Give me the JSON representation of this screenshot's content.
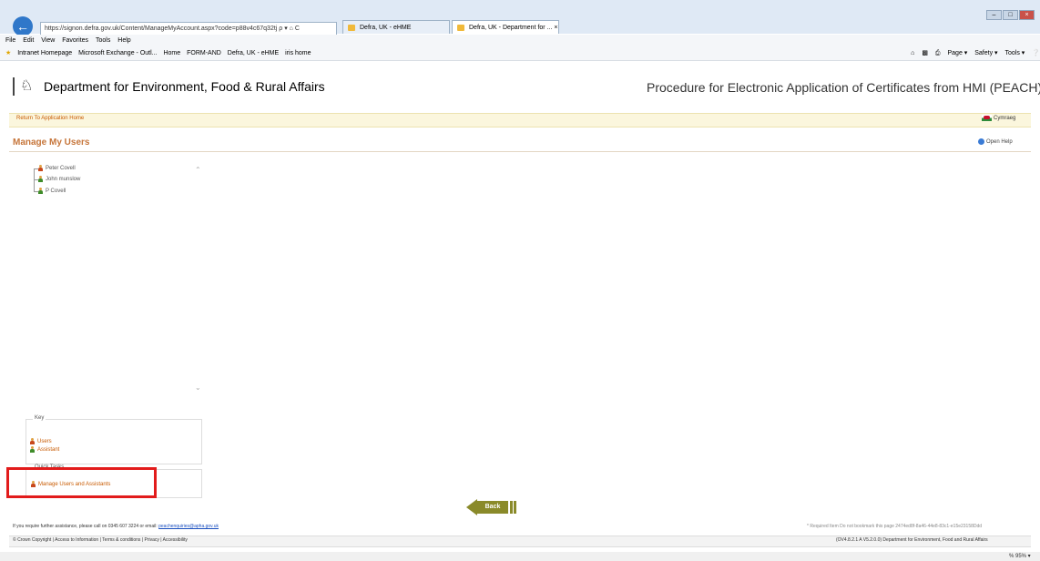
{
  "browser": {
    "address": "https://signon.defra.gov.uk/Content/ManageMyAccount.aspx?code=p88v4c67q32tj",
    "address_suffix": "ρ ▾ ⌂ C",
    "tabs": [
      {
        "label": "Defra, UK - eHME"
      },
      {
        "label": "Defra, UK - Department for ... ×"
      }
    ],
    "menu": [
      "File",
      "Edit",
      "View",
      "Favorites",
      "Tools",
      "Help"
    ],
    "favorites": [
      "Intranet Homepage",
      "Microsoft Exchange - Outl...",
      "Home",
      "FORM-AND",
      "Defra, UK - eHME",
      "iris home"
    ],
    "commands": [
      "Page ▾",
      "Safety ▾",
      "Tools ▾"
    ]
  },
  "header": {
    "department": "Department for Environment, Food & Rural Affairs",
    "service": "Procedure for Electronic Application of Certificates from HMI (PEACH)"
  },
  "nav": {
    "return_link": "Return To Application Home",
    "language": "Cymraeg",
    "help": "Open Help"
  },
  "page": {
    "title": "Manage My Users"
  },
  "tree": {
    "nodes": [
      {
        "label": "Peter Covell",
        "type": "user"
      },
      {
        "label": "John munslow",
        "type": "assistant"
      },
      {
        "label": "P Covell",
        "type": "assistant"
      }
    ]
  },
  "key": {
    "label": "Key",
    "items": [
      {
        "label": "Users",
        "type": "user"
      },
      {
        "label": "Assistant",
        "type": "assistant"
      }
    ]
  },
  "actions": {
    "label": "Quick Tasks",
    "manage": "Manage Users and Assistants"
  },
  "back_label": "Back",
  "footer": {
    "assist_text": "If you require further assistance, please call on 0345 607 3224 or email:",
    "assist_email": "peachenquiries@apha.gov.uk",
    "required": "* Required Item   Do not bookmark this page 2474ed8f-8a46-44e8-83c1-e15e23158Ddd",
    "links": "© Crown Copyright | Access to Information | Terms & conditions | Privacy | Accessibility",
    "version": "(OV4.8.2.1 A V5.2.0.0) Department for Environment, Food and Rural Affairs"
  },
  "status": {
    "zoom": "% 95% ▾"
  }
}
